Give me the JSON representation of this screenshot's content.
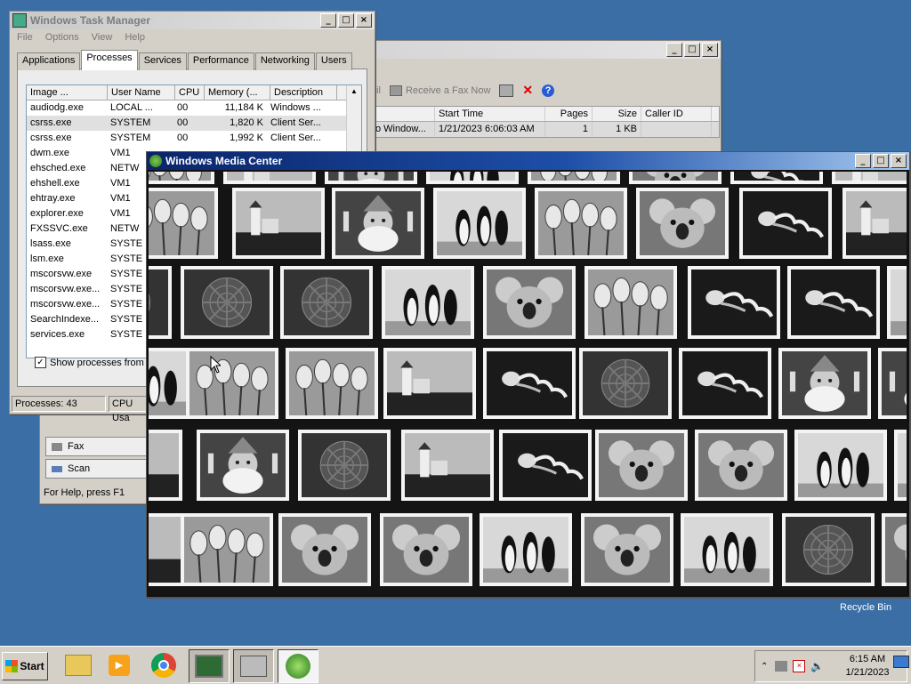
{
  "taskmgr": {
    "title": "Windows Task Manager",
    "menu": [
      "File",
      "Options",
      "View",
      "Help"
    ],
    "tabs": [
      "Applications",
      "Processes",
      "Services",
      "Performance",
      "Networking",
      "Users"
    ],
    "columns": [
      "Image ...",
      "User Name",
      "CPU",
      "Memory (...",
      "Description"
    ],
    "rows": [
      [
        "audiodg.exe",
        "LOCAL ...",
        "00",
        "11,184 K",
        "Windows ..."
      ],
      [
        "csrss.exe",
        "SYSTEM",
        "00",
        "1,820 K",
        "Client Ser..."
      ],
      [
        "csrss.exe",
        "SYSTEM",
        "00",
        "1,992 K",
        "Client Ser..."
      ],
      [
        "dwm.exe",
        "VM1",
        "",
        "",
        ""
      ],
      [
        "ehsched.exe",
        "NETW",
        "",
        "",
        ""
      ],
      [
        "ehshell.exe",
        "VM1",
        "",
        "",
        ""
      ],
      [
        "ehtray.exe",
        "VM1",
        "",
        "",
        ""
      ],
      [
        "explorer.exe",
        "VM1",
        "",
        "",
        ""
      ],
      [
        "FXSSVC.exe",
        "NETW",
        "",
        "",
        ""
      ],
      [
        "lsass.exe",
        "SYSTE",
        "",
        "",
        ""
      ],
      [
        "lsm.exe",
        "SYSTE",
        "",
        "",
        ""
      ],
      [
        "mscorsvw.exe",
        "SYSTE",
        "",
        "",
        ""
      ],
      [
        "mscorsvw.exe...",
        "SYSTE",
        "",
        "",
        ""
      ],
      [
        "mscorsvw.exe...",
        "SYSTE",
        "",
        "",
        ""
      ],
      [
        "SearchIndexe...",
        "SYSTE",
        "",
        "",
        ""
      ],
      [
        "services.exe",
        "SYSTE",
        "",
        "",
        ""
      ]
    ],
    "show_all_label": "Show processes from a",
    "status_processes": "Processes: 43",
    "status_cpu": "CPU Usa"
  },
  "fax": {
    "toolbar_partial": "ail",
    "receive_label": "Receive a Fax Now",
    "columns": [
      "",
      "Start Time",
      "Pages",
      "Size",
      "Caller ID"
    ],
    "row": [
      "o Window...",
      "1/21/2023 6:06:03 AM",
      "1",
      "1 KB",
      ""
    ],
    "side_items": [
      "Fax",
      "Scan"
    ],
    "status": "For Help, press F1"
  },
  "wmc": {
    "title": "Windows Media Center",
    "photo_subjects": [
      "tulips",
      "lighthouse",
      "santa",
      "penguins",
      "koala",
      "jellyfish",
      "chrysanthemum"
    ]
  },
  "desktop": {
    "recycle_bin": "Recycle Bin"
  },
  "taskbar": {
    "start_label": "Start",
    "time": "6:15 AM",
    "date": "1/21/2023"
  }
}
